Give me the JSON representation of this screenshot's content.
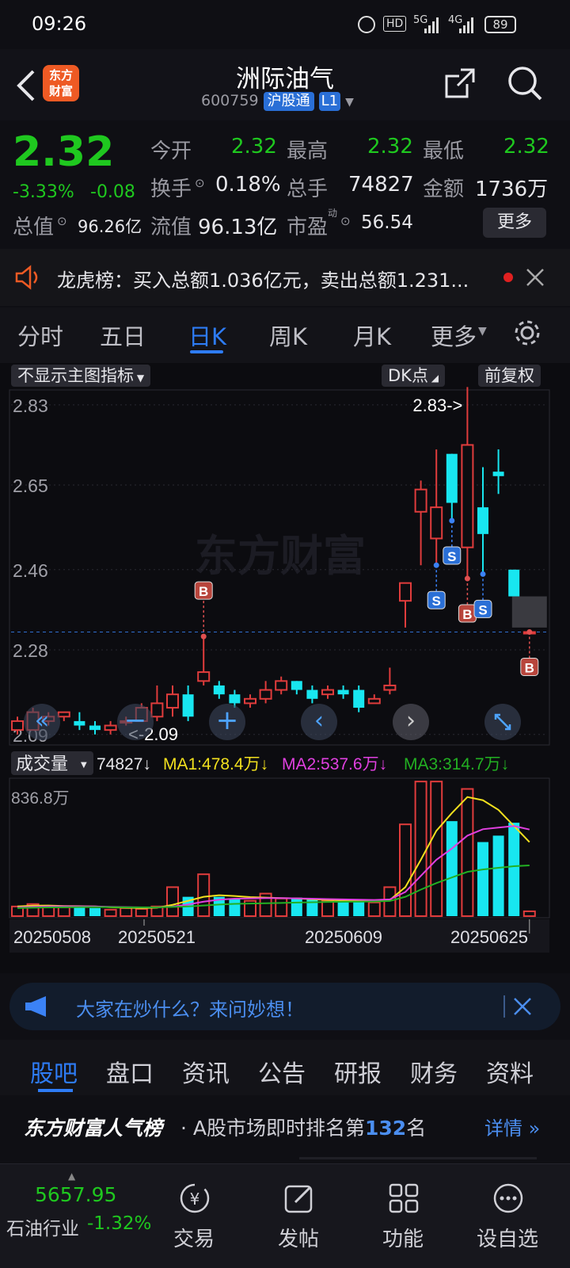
{
  "status": {
    "time": "09:26",
    "hd": "HD",
    "net1": "5G",
    "net2": "4G",
    "battery": "89"
  },
  "nav": {
    "title": "洲际油气",
    "code": "600759",
    "badge": "沪股通",
    "level": "L1",
    "logo": "东方\n财富"
  },
  "quote": {
    "price": "2.32",
    "change_pct": "-3.33%",
    "change": "-0.08",
    "open_label": "今开",
    "open": "2.32",
    "high_label": "最高",
    "high": "2.32",
    "low_label": "最低",
    "low": "2.32",
    "turnover_label": "换手",
    "turnover": "0.18%",
    "volume_label": "总手",
    "volume": "74827",
    "amount_label": "金额",
    "amount": "1736万",
    "mktcap_label": "总值",
    "mktcap": "96.26亿",
    "float_label": "流值",
    "float": "96.13亿",
    "pe_label": "市盈",
    "pe_sup": "动",
    "pe": "56.54",
    "more": "更多"
  },
  "notice": {
    "text": "龙虎榜：买入总额1.036亿元，卖出总额1.231..."
  },
  "tabs": {
    "items": [
      "分时",
      "五日",
      "日K",
      "周K",
      "月K",
      "更多"
    ],
    "active": "日K"
  },
  "chart_toolbar": {
    "indicator": "不显示主图指标",
    "dk": "DK点",
    "adjust": "前复权"
  },
  "chart_data": {
    "type": "candlestick",
    "y_ticks": [
      "2.83",
      "2.65",
      "2.46",
      "2.28",
      "2.09"
    ],
    "ylim": [
      2.07,
      2.86
    ],
    "last_price": 2.32,
    "annot_high": "2.83->",
    "annot_low": "<-2.09",
    "x_ticks": [
      "20250508",
      "20250521",
      "20250609",
      "20250625"
    ],
    "candles": [
      {
        "o": 2.1,
        "c": 2.12,
        "h": 2.13,
        "l": 2.09
      },
      {
        "o": 2.1,
        "c": 2.14,
        "h": 2.15,
        "l": 2.1
      },
      {
        "o": 2.12,
        "c": 2.13,
        "h": 2.14,
        "l": 2.11
      },
      {
        "o": 2.13,
        "c": 2.14,
        "h": 2.14,
        "l": 2.12
      },
      {
        "o": 2.12,
        "c": 2.11,
        "h": 2.14,
        "l": 2.1
      },
      {
        "o": 2.11,
        "c": 2.1,
        "h": 2.12,
        "l": 2.09
      },
      {
        "o": 2.1,
        "c": 2.11,
        "h": 2.12,
        "l": 2.09
      },
      {
        "o": 2.12,
        "c": 2.12,
        "h": 2.13,
        "l": 2.11
      },
      {
        "o": 2.12,
        "c": 2.15,
        "h": 2.16,
        "l": 2.12
      },
      {
        "o": 2.13,
        "c": 2.16,
        "h": 2.2,
        "l": 2.12
      },
      {
        "o": 2.15,
        "c": 2.18,
        "h": 2.2,
        "l": 2.13
      },
      {
        "o": 2.18,
        "c": 2.13,
        "h": 2.2,
        "l": 2.12
      },
      {
        "o": 2.21,
        "c": 2.23,
        "h": 2.31,
        "l": 2.2
      },
      {
        "o": 2.2,
        "c": 2.18,
        "h": 2.21,
        "l": 2.17
      },
      {
        "o": 2.18,
        "c": 2.16,
        "h": 2.19,
        "l": 2.15
      },
      {
        "o": 2.16,
        "c": 2.17,
        "h": 2.18,
        "l": 2.15
      },
      {
        "o": 2.17,
        "c": 2.19,
        "h": 2.21,
        "l": 2.16
      },
      {
        "o": 2.19,
        "c": 2.21,
        "h": 2.22,
        "l": 2.18
      },
      {
        "o": 2.21,
        "c": 2.19,
        "h": 2.21,
        "l": 2.18
      },
      {
        "o": 2.19,
        "c": 2.17,
        "h": 2.2,
        "l": 2.16
      },
      {
        "o": 2.18,
        "c": 2.19,
        "h": 2.2,
        "l": 2.17
      },
      {
        "o": 2.19,
        "c": 2.18,
        "h": 2.2,
        "l": 2.17
      },
      {
        "o": 2.19,
        "c": 2.15,
        "h": 2.2,
        "l": 2.14
      },
      {
        "o": 2.16,
        "c": 2.17,
        "h": 2.18,
        "l": 2.16
      },
      {
        "o": 2.19,
        "c": 2.2,
        "h": 2.24,
        "l": 2.18
      },
      {
        "o": 2.39,
        "c": 2.43,
        "h": 2.43,
        "l": 2.33
      },
      {
        "o": 2.59,
        "c": 2.64,
        "h": 2.66,
        "l": 2.47
      },
      {
        "o": 2.53,
        "c": 2.6,
        "h": 2.73,
        "l": 2.47
      },
      {
        "o": 2.72,
        "c": 2.61,
        "h": 2.72,
        "l": 2.57
      },
      {
        "o": 2.51,
        "c": 2.74,
        "h": 2.87,
        "l": 2.44
      },
      {
        "o": 2.6,
        "c": 2.54,
        "h": 2.69,
        "l": 2.45
      },
      {
        "o": 2.68,
        "c": 2.67,
        "h": 2.73,
        "l": 2.63
      },
      {
        "o": 2.46,
        "c": 2.4,
        "h": 2.46,
        "l": 2.4
      },
      {
        "o": 2.32,
        "c": 2.32,
        "h": 2.32,
        "l": 2.32
      }
    ],
    "signals": [
      {
        "i": 12,
        "type": "B",
        "pos": "above"
      },
      {
        "i": 27,
        "type": "S",
        "pos": "below"
      },
      {
        "i": 28,
        "type": "S",
        "pos": "below"
      },
      {
        "i": 29,
        "type": "B",
        "pos": "below"
      },
      {
        "i": 30,
        "type": "S",
        "pos": "below"
      },
      {
        "i": 33,
        "type": "B",
        "pos": "below"
      }
    ],
    "volume": {
      "label": "成交量",
      "last": "74827",
      "max_label": "836.8万",
      "max": 836.8,
      "ma1_label": "MA1:478.4万",
      "ma2_label": "MA2:537.6万",
      "ma3_label": "MA3:314.7万",
      "ma1_color": "#f2e01e",
      "ma2_color": "#e040e0",
      "ma3_color": "#22b022",
      "values": [
        60,
        75,
        60,
        55,
        60,
        50,
        40,
        50,
        45,
        60,
        180,
        120,
        260,
        120,
        110,
        95,
        140,
        110,
        115,
        105,
        95,
        90,
        105,
        85,
        180,
        570,
        836,
        836,
        590,
        790,
        460,
        500,
        580,
        30
      ],
      "ma1": [
        60,
        65,
        66,
        63,
        62,
        60,
        55,
        52,
        50,
        52,
        70,
        95,
        120,
        130,
        125,
        118,
        115,
        112,
        110,
        105,
        100,
        98,
        96,
        92,
        100,
        180,
        350,
        530,
        640,
        740,
        720,
        660,
        560,
        460
      ],
      "ma2": [
        55,
        58,
        60,
        61,
        61,
        60,
        58,
        56,
        54,
        54,
        60,
        72,
        90,
        102,
        108,
        110,
        112,
        112,
        110,
        108,
        106,
        104,
        102,
        100,
        104,
        150,
        250,
        350,
        420,
        500,
        540,
        550,
        560,
        538
      ],
      "ma3": [
        50,
        52,
        54,
        55,
        56,
        56,
        56,
        55,
        55,
        55,
        57,
        60,
        66,
        72,
        76,
        78,
        80,
        82,
        84,
        86,
        88,
        89,
        90,
        91,
        94,
        120,
        165,
        205,
        240,
        275,
        290,
        300,
        310,
        315
      ]
    },
    "red": "#e03c3c",
    "cyan": "#18e6f0"
  },
  "ask": {
    "text": "大家在炒什么？来问妙想！"
  },
  "subtabs": {
    "items": [
      "股吧",
      "盘口",
      "资讯",
      "公告",
      "研报",
      "财务",
      "资料"
    ],
    "active": "股吧"
  },
  "rank": {
    "brand": "东方财富人气榜",
    "prefix": "· A股市场即时排名第",
    "num": "132",
    "suffix": "名",
    "detail": "详情"
  },
  "bottom": {
    "index_value": "5657.95",
    "index_name": "石油行业",
    "index_pct": "-1.32%",
    "items": [
      "交易",
      "发帖",
      "功能",
      "设自选"
    ]
  },
  "watermark": "东方财富"
}
